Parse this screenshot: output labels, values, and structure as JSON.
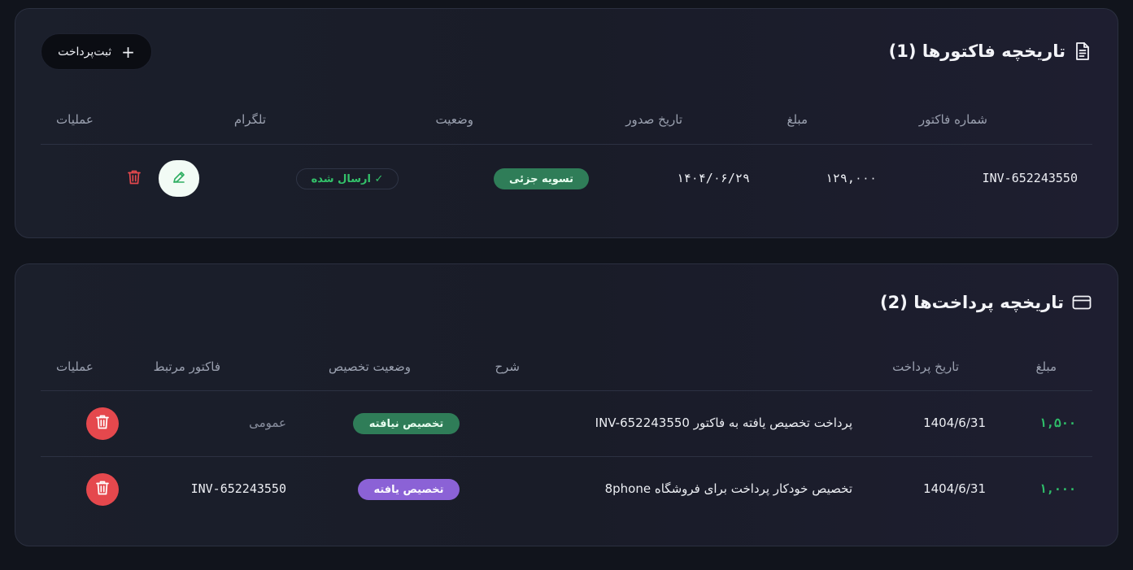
{
  "invoices": {
    "title": "تاریخچه فاکتورها (1)",
    "title_icon": "document-icon",
    "add_button_label": "ثبت‌پرداخت",
    "add_button_icon": "plus-icon",
    "columns": {
      "number": "شماره فاکتور",
      "amount": "مبلغ",
      "date": "تاریخ صدور",
      "status": "وضعیت",
      "telegram": "تلگرام",
      "actions": "عملیات"
    },
    "rows": [
      {
        "number": "INV-652243550",
        "amount": "۱۲۹,۰۰۰",
        "date": "۱۴۰۴/۰۶/۲۹",
        "status": "تسویه جزئی",
        "telegram": "✓ ارسال شده",
        "edit_icon": "pencil-icon",
        "delete_icon": "trash-icon"
      }
    ]
  },
  "payments": {
    "title": "تاریخچه پرداخت‌ها (2)",
    "title_icon": "credit-card-icon",
    "columns": {
      "amount": "مبلغ",
      "date": "تاریخ پرداخت",
      "description": "شرح",
      "allocation": "وضعیت تخصیص",
      "invoice": "فاکتور مرتبط",
      "actions": "عملیات"
    },
    "rows": [
      {
        "amount": "۱,۵۰۰",
        "date": "1404/6/31",
        "description": "پرداخت تخصیص یافته به فاکتور INV-652243550",
        "allocation": "تخصیص نیافته",
        "invoice": "عمومی",
        "delete_icon": "trash-icon"
      },
      {
        "amount": "۱,۰۰۰",
        "date": "1404/6/31",
        "description": "تخصیص خودکار پرداخت برای فروشگاه 8phone",
        "allocation": "تخصیص یافته",
        "invoice": "INV-652243550",
        "delete_icon": "trash-icon"
      }
    ]
  },
  "colors": {
    "background": "#11141c",
    "card_border": "#2b3040",
    "status_green": "#2f7d58",
    "status_purple": "#8b62d6",
    "amount_green": "#2fbf6a",
    "danger_red": "#e5484d",
    "telegram_green": "#33c26a"
  }
}
